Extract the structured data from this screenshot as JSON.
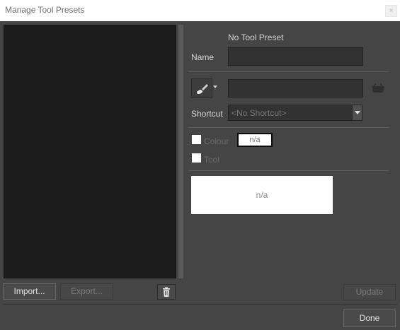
{
  "window": {
    "title": "Manage Tool Presets",
    "close_glyph": "×"
  },
  "left_panel": {
    "presets": [],
    "import_label": "Import...",
    "export_label": "Export..."
  },
  "details": {
    "header": "No Tool Preset",
    "name_label": "Name",
    "name_value": "",
    "tool_name_value": "",
    "shortcut_label": "Shortcut",
    "shortcut_value": "<No Shortcut>",
    "colour_label": "Colour",
    "colour_swatch_text": "n/a",
    "tool_label": "Tool",
    "preview_text": "n/a"
  },
  "buttons": {
    "update_label": "Update",
    "done_label": "Done"
  },
  "icons": {
    "current_tool": "brush-icon",
    "tool_dropdown": "caret-down-icon",
    "basket": "basket-icon",
    "delete": "trash-icon"
  }
}
